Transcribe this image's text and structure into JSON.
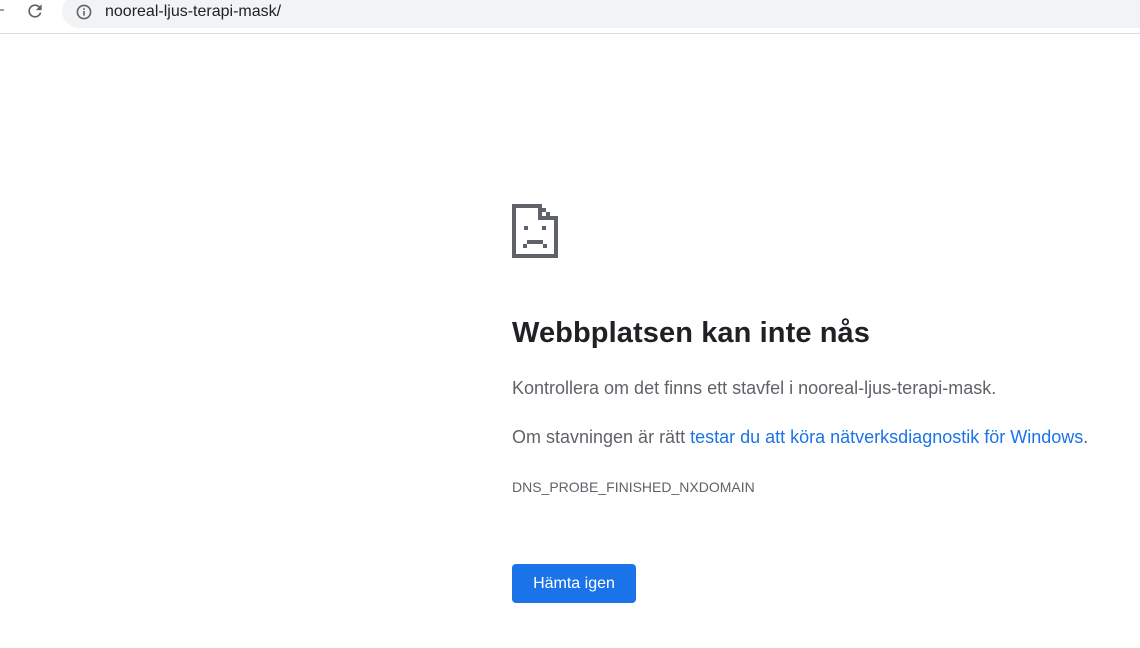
{
  "toolbar": {
    "reload_icon": "reload-icon",
    "info_icon": "info-icon",
    "url": "nooreal-ljus-terapi-mask/"
  },
  "error": {
    "icon": "sad-page-icon",
    "title": "Webbplatsen kan inte nås",
    "suggestion_spelling": "Kontrollera om det finns ett stavfel i nooreal-ljus-terapi-mask.",
    "suggestion_diag_prefix": "Om stavningen är rätt ",
    "suggestion_diag_link": "testar du att köra nätverksdiagnostik för Windows",
    "suggestion_diag_suffix": ".",
    "code": "DNS_PROBE_FINISHED_NXDOMAIN",
    "reload_label": "Hämta igen"
  },
  "colors": {
    "accent": "#1a73e8",
    "title_text": "#202124",
    "body_text": "#5f6368",
    "omnibox_bg": "#f1f3f4"
  }
}
